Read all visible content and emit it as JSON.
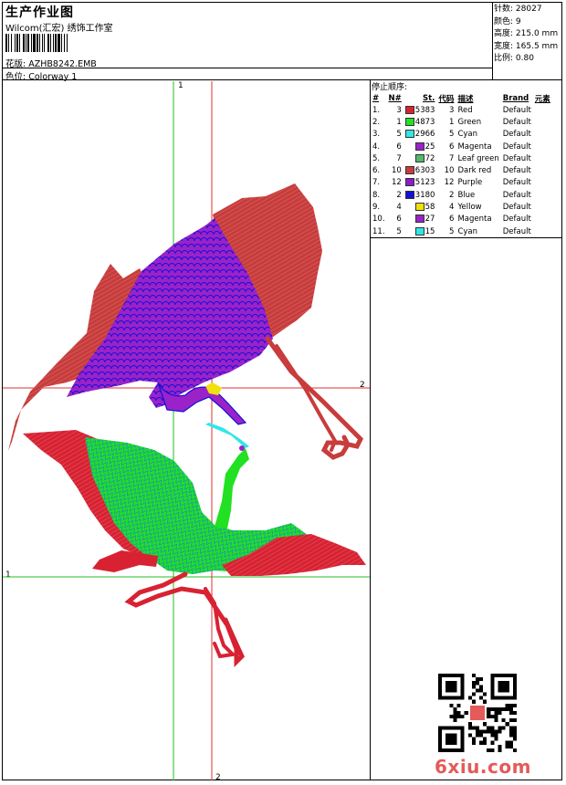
{
  "header": {
    "title": "生产作业图",
    "company": "Wilcom(汇宏) 绣饰工作室",
    "design_label": "花版:",
    "design_file": "AZHB8242.EMB",
    "colorway_label": "色位:",
    "colorway": "Colorway 1"
  },
  "stats": [
    {
      "label": "针数:",
      "value": "28027"
    },
    {
      "label": "颜色:",
      "value": "9"
    },
    {
      "label": "高度:",
      "value": "215.0 mm"
    },
    {
      "label": "宽度:",
      "value": "165.5 mm"
    },
    {
      "label": "比例:",
      "value": "0.80"
    }
  ],
  "stop_sequence": {
    "title": "停止顺序:",
    "headers": [
      "#",
      "N#",
      "St.",
      "代码",
      "描述",
      "Brand",
      "元素"
    ],
    "rows": [
      {
        "idx": "1.",
        "n": "3",
        "color": "#d82232",
        "st": "5383",
        "code": "3",
        "desc": "Red",
        "brand": "Default"
      },
      {
        "idx": "2.",
        "n": "1",
        "color": "#22e022",
        "st": "4873",
        "code": "1",
        "desc": "Green",
        "brand": "Default"
      },
      {
        "idx": "3.",
        "n": "5",
        "color": "#32e6e6",
        "st": "2966",
        "code": "5",
        "desc": "Cyan",
        "brand": "Default"
      },
      {
        "idx": "4.",
        "n": "6",
        "color": "#9a22c8",
        "st": "25",
        "code": "6",
        "desc": "Magenta",
        "brand": "Default"
      },
      {
        "idx": "5.",
        "n": "7",
        "color": "#52b86a",
        "st": "72",
        "code": "7",
        "desc": "Leaf green",
        "brand": "Default"
      },
      {
        "idx": "6.",
        "n": "10",
        "color": "#c83c3c",
        "st": "6303",
        "code": "10",
        "desc": "Dark red",
        "brand": "Default"
      },
      {
        "idx": "7.",
        "n": "12",
        "color": "#8a1ec8",
        "st": "5123",
        "code": "12",
        "desc": "Purple",
        "brand": "Default"
      },
      {
        "idx": "8.",
        "n": "2",
        "color": "#1212d8",
        "st": "3180",
        "code": "2",
        "desc": "Blue",
        "brand": "Default"
      },
      {
        "idx": "9.",
        "n": "4",
        "color": "#f0e010",
        "st": "58",
        "code": "4",
        "desc": "Yellow",
        "brand": "Default"
      },
      {
        "idx": "10.",
        "n": "6",
        "color": "#9a22c8",
        "st": "27",
        "code": "6",
        "desc": "Magenta",
        "brand": "Default"
      },
      {
        "idx": "11.",
        "n": "5",
        "color": "#32e6e6",
        "st": "15",
        "code": "5",
        "desc": "Cyan",
        "brand": "Default"
      }
    ]
  },
  "guides": {
    "green_top": "1",
    "green_left": "1",
    "red_right": "2",
    "red_bottom": "2"
  },
  "watermark": "6xiu.com"
}
